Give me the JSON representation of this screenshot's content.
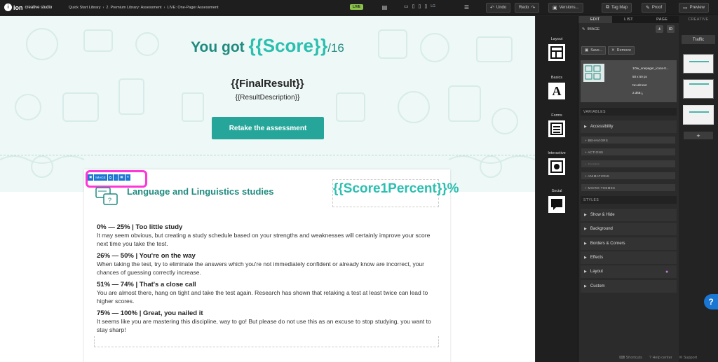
{
  "app": {
    "brand_mark": "i",
    "brand": "ion",
    "brand_sub": "creative studio"
  },
  "breadcrumbs": [
    "Quick Start Library",
    "2. Premium Library: Assessment",
    "LIVE: One-Pager Assessment"
  ],
  "status_badge": "LIVE",
  "devices": {
    "lg_label": "LG"
  },
  "toolbar": {
    "undo": "Undo",
    "redo": "Redo",
    "versions": "Versions...",
    "tag_map": "Tag Map",
    "proof": "Proof",
    "preview": "Preview"
  },
  "hero": {
    "prefix": "You got ",
    "score": "{{Score}}",
    "suffix": "/16",
    "final_result": "{{FinalResult}}",
    "result_description": "{{ResultDescription}}",
    "retake_label": "Retake the assessment"
  },
  "card": {
    "toolbar_label": "IMAGE",
    "title": "Language and Linguistics studies",
    "percent": "{{Score1Percent}}%",
    "ranges": [
      {
        "title": "0% — 25% | Too little study",
        "desc": "It may seem obvious, but creating a study schedule based on your strengths and weaknesses will certainly improve your score next time you take the test."
      },
      {
        "title": "26% — 50% | You're on the way",
        "desc": "When taking the test, try to eliminate the answers which you're not immediately confident or already know are incorrect, your chances of guessing correctly increase."
      },
      {
        "title": "51% — 74% | That's a close call",
        "desc": "You are almost there, hang on tight and take the test again. Research has shown that retaking a test at least twice can lead to higher scores."
      },
      {
        "title": "75% — 100% | Great, you nailed it",
        "desc": "It seems like you are mastering this discipline, way to go! But please do not use this as an excuse to stop studying, you want to stay sharp!"
      }
    ]
  },
  "modules": [
    {
      "label": "Layout",
      "icon": "layout-icon"
    },
    {
      "label": "Basics",
      "icon": "text-a-icon",
      "glyph": "A"
    },
    {
      "label": "Forms",
      "icon": "form-icon"
    },
    {
      "label": "Interactive",
      "icon": "video-icon"
    },
    {
      "label": "Social",
      "icon": "chat-icon"
    }
  ],
  "panel": {
    "tabs": [
      "EDIT",
      "LIST",
      "PAGE"
    ],
    "element_label": "IMAGE",
    "id_label": "ID",
    "save_label": "Save...",
    "remove_label": "Remove",
    "asset": {
      "name": "1Ow_onepager_icons-0...",
      "size": "50 x 50 px",
      "alt": "No alt text",
      "filesize": "2.3kB"
    },
    "variables_header": "VARIABLES",
    "accessibility": "Accessibility",
    "behaviors": "+ BEHAVIORS",
    "actions": "+ ACTIONS",
    "pages": "+ PAGES",
    "animations": "+ ANIMATIONS",
    "micro_themes": "+ MICRO-THEMES",
    "styles_header": "STYLES",
    "styles": [
      "Show & Hide",
      "Background",
      "Borders & Corners",
      "Effects",
      "Layout",
      "Custom"
    ]
  },
  "creative": {
    "title": "CREATIVE",
    "traffic": "Traffic",
    "add": "+"
  },
  "help": "?",
  "footer": {
    "shortcuts": "Shortcuts",
    "help_center": "Help center",
    "support": "Support"
  },
  "colors": {
    "accent": "#26a69a",
    "accent_light": "#2bbfb0",
    "highlight": "#ff36d8",
    "selection": "#1976d2",
    "live": "#8bc34a"
  }
}
